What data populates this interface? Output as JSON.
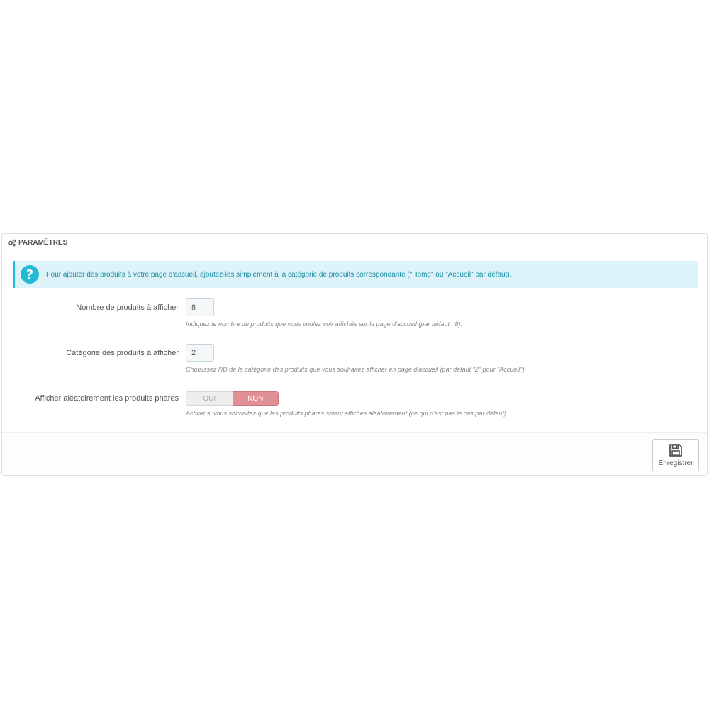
{
  "panel": {
    "heading": "PARAMÈTRES",
    "heading_icon": "gears-icon"
  },
  "alert": {
    "icon": "question-icon",
    "text": "Pour ajouter des produits à votre page d'accueil, ajoutez-les simplement à la catégorie de produits correspondante (\"Home\" ou \"Accueil\" par défaut)."
  },
  "fields": {
    "nb_products": {
      "label": "Nombre de produits à afficher",
      "value": "8",
      "help": "Indiquez le nombre de produits que vous voulez voir affichés sur la page d'accueil (par défaut : 8)."
    },
    "category": {
      "label": "Catégorie des produits à afficher",
      "value": "2",
      "help": "Choisissez l'ID de la catégorie des produits que vous souhaitez afficher en page d'accueil (par défaut \"2\" pour \"Accueil\")."
    },
    "random": {
      "label": "Afficher aléatoirement les produits phares",
      "yes_label": "OUI",
      "no_label": "NON",
      "selected": "NON",
      "help": "Activer si vous souhaitez que les produits phares soient affichés aléatoirement (ce qui n'est pas le cas par défaut)."
    }
  },
  "footer": {
    "save_label": "Enregistrer",
    "save_icon": "floppy-disk-icon"
  },
  "colors": {
    "info_accent": "#25b9d7",
    "info_background": "#dcf4f9",
    "switch_no_active": "#e08f95"
  }
}
